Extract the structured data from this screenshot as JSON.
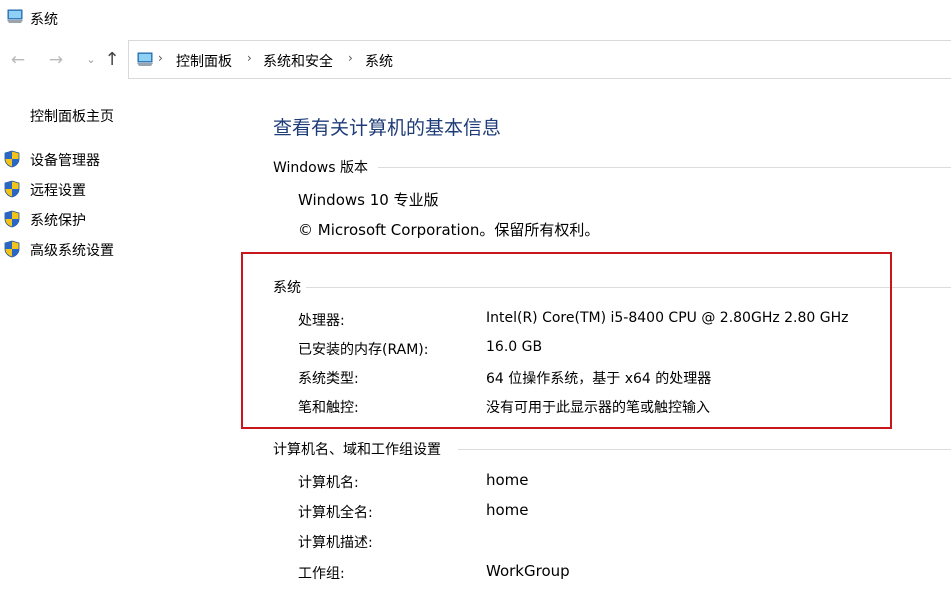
{
  "window": {
    "title": "系统"
  },
  "nav": {
    "back_icon": "←",
    "forward_icon": "→",
    "recent_icon": "⌄",
    "up_icon": "↑",
    "breadcrumb": [
      "控制面板",
      "系统和安全",
      "系统"
    ],
    "separator": "›"
  },
  "sidebar": {
    "home": "控制面板主页",
    "items": [
      {
        "label": "设备管理器",
        "icon": "shield-icon"
      },
      {
        "label": "远程设置",
        "icon": "shield-icon"
      },
      {
        "label": "系统保护",
        "icon": "shield-icon"
      },
      {
        "label": "高级系统设置",
        "icon": "shield-icon"
      }
    ]
  },
  "main": {
    "title": "查看有关计算机的基本信息",
    "windows_edition": {
      "heading": "Windows 版本",
      "edition": "Windows 10 专业版",
      "copyright": "© Microsoft Corporation。保留所有权利。"
    },
    "system": {
      "heading": "系统",
      "rows": [
        {
          "label": "处理器:",
          "value": "Intel(R) Core(TM) i5-8400 CPU @ 2.80GHz   2.80 GHz"
        },
        {
          "label": "已安装的内存(RAM):",
          "value": "16.0 GB"
        },
        {
          "label": "系统类型:",
          "value": "64 位操作系统，基于 x64 的处理器"
        },
        {
          "label": "笔和触控:",
          "value": "没有可用于此显示器的笔或触控输入"
        }
      ]
    },
    "computer_name": {
      "heading": "计算机名、域和工作组设置",
      "rows": [
        {
          "label": "计算机名:",
          "value": "home"
        },
        {
          "label": "计算机全名:",
          "value": "home"
        },
        {
          "label": "计算机描述:",
          "value": ""
        },
        {
          "label": "工作组:",
          "value": "WorkGroup"
        }
      ]
    }
  },
  "colors": {
    "title_blue": "#1e3c78",
    "highlight_red": "#c8171b"
  }
}
